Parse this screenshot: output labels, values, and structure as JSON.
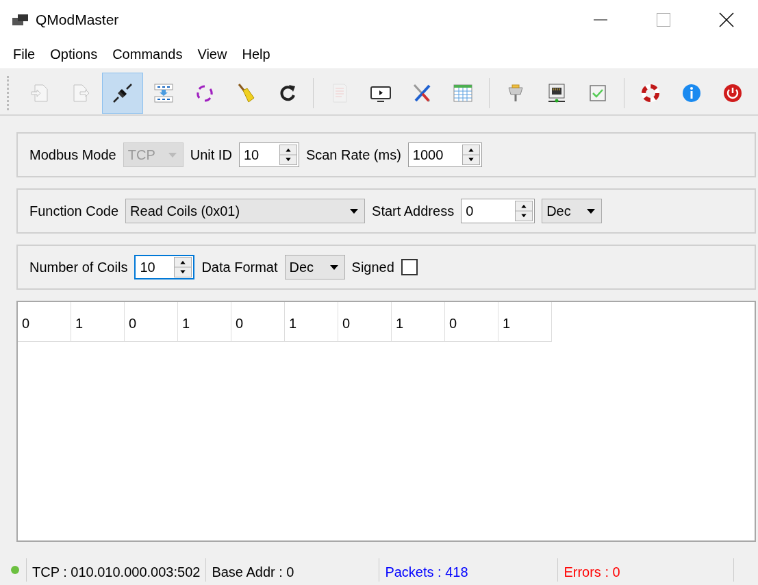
{
  "window": {
    "title": "QModMaster"
  },
  "menu": [
    "File",
    "Options",
    "Commands",
    "View",
    "Help"
  ],
  "toolbar": {
    "groups": [
      [
        {
          "kind": "load",
          "selected": false,
          "disabled": true
        },
        {
          "kind": "save",
          "selected": false,
          "disabled": true
        },
        {
          "kind": "connect",
          "selected": true,
          "disabled": false
        },
        {
          "kind": "read-write",
          "selected": false,
          "disabled": false
        },
        {
          "kind": "scan",
          "selected": false,
          "disabled": false
        },
        {
          "kind": "clear",
          "selected": false,
          "disabled": false
        },
        {
          "kind": "reset",
          "selected": false,
          "disabled": false
        }
      ],
      [
        {
          "kind": "log",
          "selected": false,
          "disabled": true
        },
        {
          "kind": "monitor",
          "selected": false,
          "disabled": false
        },
        {
          "kind": "tools",
          "selected": false,
          "disabled": false
        },
        {
          "kind": "table",
          "selected": false,
          "disabled": false
        }
      ],
      [
        {
          "kind": "serial",
          "selected": false,
          "disabled": false
        },
        {
          "kind": "network",
          "selected": false,
          "disabled": false
        },
        {
          "kind": "check",
          "selected": false,
          "disabled": false
        }
      ],
      [
        {
          "kind": "help",
          "selected": false,
          "disabled": false
        },
        {
          "kind": "about",
          "selected": false,
          "disabled": false
        },
        {
          "kind": "exit",
          "selected": false,
          "disabled": false
        }
      ]
    ]
  },
  "panels": [
    [
      {
        "kind": "label",
        "text": "Modbus Mode"
      },
      {
        "kind": "combo",
        "value": "TCP",
        "disabled": true
      },
      {
        "kind": "label",
        "text": "Unit ID"
      },
      {
        "kind": "spin",
        "value": "10",
        "focused": false
      },
      {
        "kind": "label",
        "text": "Scan Rate (ms)"
      },
      {
        "kind": "spin",
        "value": "1000",
        "focused": false
      }
    ],
    [
      {
        "kind": "label",
        "text": "Function Code"
      },
      {
        "kind": "combo",
        "value": "Read Coils (0x01)",
        "disabled": false
      },
      {
        "kind": "label",
        "text": "Start Address"
      },
      {
        "kind": "spin",
        "value": "0",
        "focused": false
      },
      {
        "kind": "combo",
        "value": "Dec",
        "disabled": false
      }
    ],
    [
      {
        "kind": "label",
        "text": "Number of Coils"
      },
      {
        "kind": "spin",
        "value": "10",
        "focused": true
      },
      {
        "kind": "label",
        "text": "Data Format"
      },
      {
        "kind": "combo",
        "value": "Dec",
        "disabled": false
      },
      {
        "kind": "label",
        "text": "Signed"
      },
      {
        "kind": "checkbox",
        "checked": false
      }
    ]
  ],
  "table": {
    "cells": [
      "0",
      "1",
      "0",
      "1",
      "0",
      "1",
      "0",
      "1",
      "0",
      "1"
    ]
  },
  "status_bar": {
    "connected": true,
    "items": [
      {
        "text": "TCP : 010.010.000.003:502",
        "color": "#000000"
      },
      {
        "text": "Base Addr : 0",
        "color": "#000000"
      },
      {
        "text": "Packets : 418",
        "color": "#0000ff"
      },
      {
        "text": "Errors : 0",
        "color": "#ff0000"
      }
    ]
  }
}
